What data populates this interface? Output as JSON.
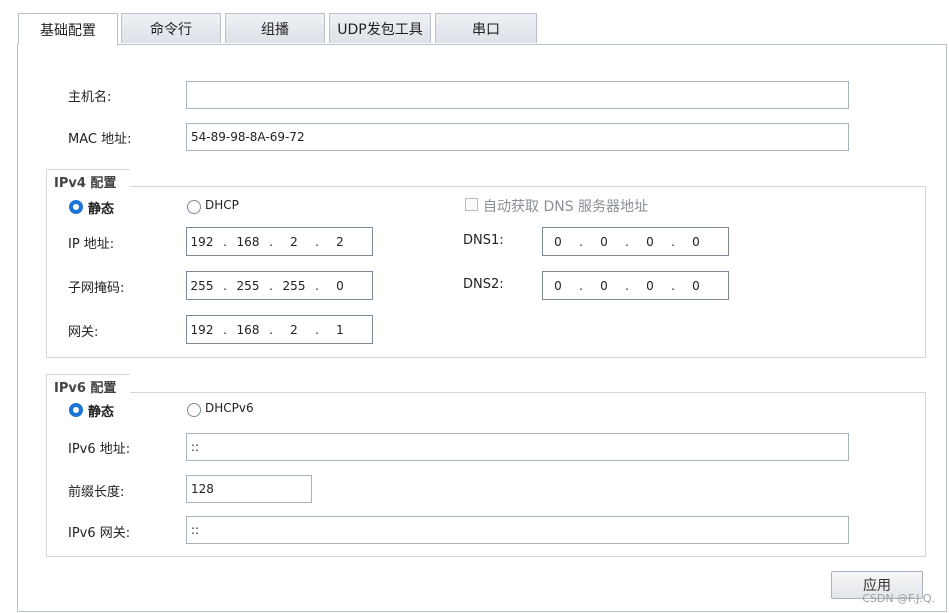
{
  "tabs": [
    "基础配置",
    "命令行",
    "组播",
    "UDP发包工具",
    "串口"
  ],
  "basic": {
    "hostname_label": "主机名:",
    "hostname_value": "",
    "mac_label": "MAC 地址:",
    "mac_value": "54-89-98-8A-69-72"
  },
  "ipv4": {
    "legend": "IPv4 配置",
    "static_label": "静态",
    "dhcp_label": "DHCP",
    "auto_dns_label": "自动获取 DNS 服务器地址",
    "ip_label": "IP 地址:",
    "ip": [
      "192",
      "168",
      "2",
      "2"
    ],
    "mask_label": "子网掩码:",
    "mask": [
      "255",
      "255",
      "255",
      "0"
    ],
    "gateway_label": "网关:",
    "gateway": [
      "192",
      "168",
      "2",
      "1"
    ],
    "dns1_label": "DNS1:",
    "dns1": [
      "0",
      "0",
      "0",
      "0"
    ],
    "dns2_label": "DNS2:",
    "dns2": [
      "0",
      "0",
      "0",
      "0"
    ]
  },
  "ipv6": {
    "legend": "IPv6 配置",
    "static_label": "静态",
    "dhcp_label": "DHCPv6",
    "addr_label": "IPv6 地址:",
    "addr_value": "::",
    "prefix_label": "前缀长度:",
    "prefix_value": "128",
    "gateway_label": "IPv6 网关:",
    "gateway_value": "::"
  },
  "apply_label": "应用",
  "watermark": "CSDN @F.J.Q."
}
